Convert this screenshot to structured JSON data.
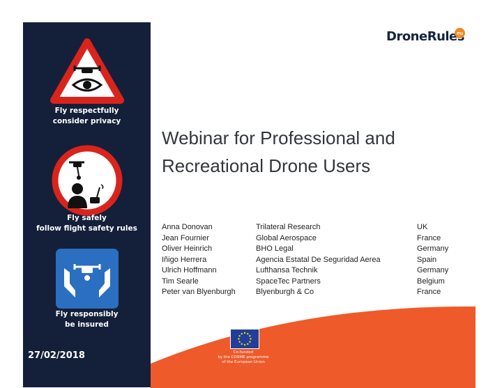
{
  "logo": {
    "text": "DroneRules",
    "badge": "eu"
  },
  "sidebar": {
    "caption_1": [
      "Fly respectfully",
      "consider privacy"
    ],
    "caption_2": [
      "Fly safely",
      "follow flight safety rules"
    ],
    "caption_3": [
      "Fly responsibly",
      "be insured"
    ]
  },
  "title": [
    "Webinar for Professional and",
    "Recreational Drone Users"
  ],
  "people": [
    [
      "Anna Donovan",
      "Trilateral Research",
      "UK"
    ],
    [
      "Jean Fournier",
      "Global Aerospace",
      "France"
    ],
    [
      "Oliver Heinrich",
      "BHO Legal",
      "Germany"
    ],
    [
      "Iñigo Herrera",
      "Agencia Estatal De Seguridad Aerea",
      "Spain"
    ],
    [
      "Ulrich Hoffmann",
      "Lufthansa Technik",
      "Germany"
    ],
    [
      "Tim Searle",
      "SpaceTec Partners",
      "Belgium"
    ],
    [
      "Peter van Blyenburgh",
      "Blyenburgh & Co",
      "France"
    ]
  ],
  "eu_notice": [
    "Co-funded",
    "by the COSME programme",
    "of the European Union"
  ],
  "date": "27/02/2018",
  "colors": {
    "sidebar": "#14203a",
    "accent_orange": "#ef5a2a",
    "warning_red": "#d9241c",
    "insurance_blue": "#2a6fc0",
    "logo_badge": "#f08a24"
  },
  "icons": [
    "privacy-warning-icon",
    "flight-safety-icon",
    "insurance-icon",
    "eu-flag-icon"
  ]
}
